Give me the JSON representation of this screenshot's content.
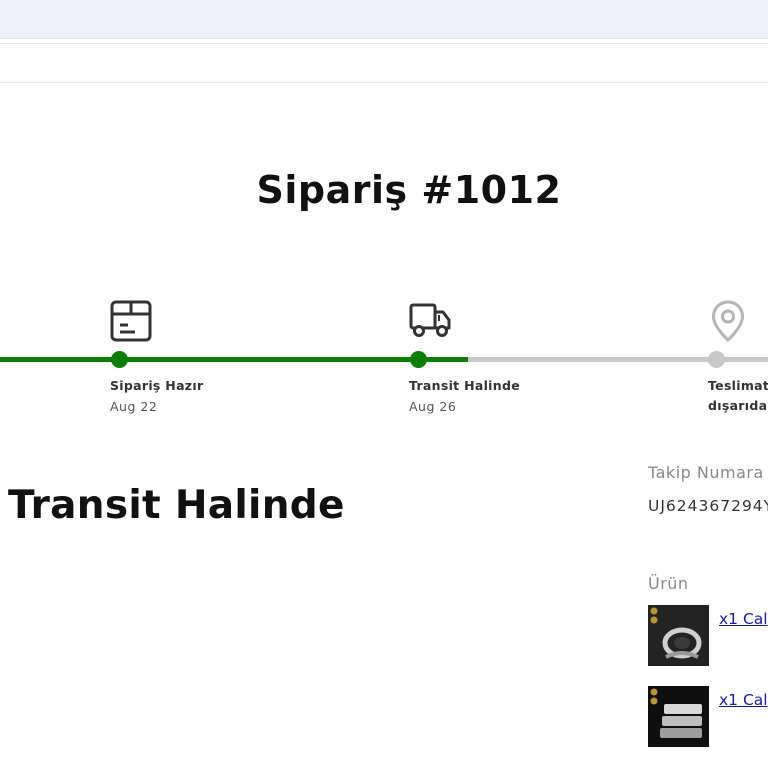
{
  "order": {
    "title": "Sipariş #1012"
  },
  "steps": [
    {
      "label": "Sipariş Hazır",
      "date": "Aug 22",
      "icon": "package-icon",
      "state": "complete"
    },
    {
      "label": "Transit Halinde",
      "date": "Aug 26",
      "icon": "truck-icon",
      "state": "current"
    },
    {
      "label": "Teslimat",
      "date": "dışarıda",
      "icon": "map-pin-icon",
      "state": "pending"
    }
  ],
  "status": {
    "heading": "Transit Halinde"
  },
  "tracking": {
    "label": "Takip Numara",
    "number": "UJ624367294Y"
  },
  "products": {
    "label": "Ürün",
    "items": [
      {
        "text": "x1 Cal"
      },
      {
        "text": "x1 Cal"
      }
    ]
  },
  "colors": {
    "progress_complete": "#0a7e07",
    "progress_pending": "#c8c8c8",
    "link": "#1a1aa8"
  }
}
